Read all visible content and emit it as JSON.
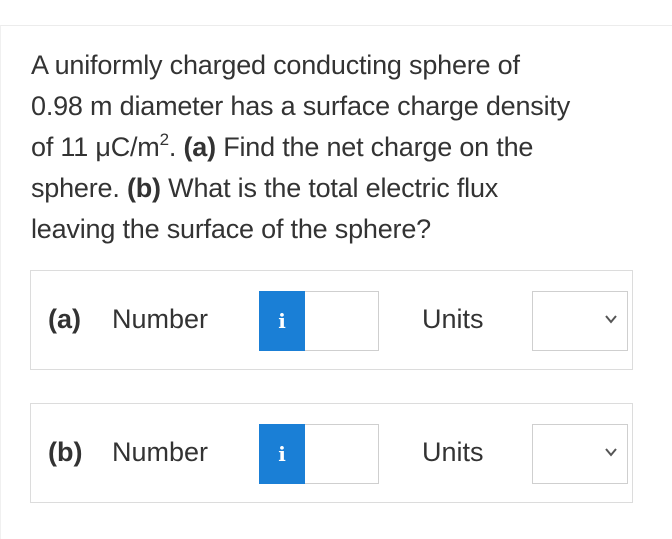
{
  "question": {
    "line1": "A uniformly charged conducting sphere of",
    "line2": "0.98 m diameter has a surface charge density",
    "line3_pre": "of 11 μC/m",
    "line3_sup": "2",
    "line3_post": ". ",
    "part_a_tag": "(a)",
    "line3_tail": " Find the net charge on the",
    "line4_pre": "sphere. ",
    "part_b_tag": "(b)",
    "line4_tail": " What is the total electric flux",
    "line5": "leaving the surface of the sphere?"
  },
  "answers": [
    {
      "part_label": "(a)",
      "number_label": "Number",
      "info_icon": "i",
      "number_value": "",
      "units_label": "Units",
      "units_value": ""
    },
    {
      "part_label": "(b)",
      "number_label": "Number",
      "info_icon": "i",
      "number_value": "",
      "units_label": "Units",
      "units_value": ""
    }
  ],
  "colors": {
    "info_button": "#1a7fd6",
    "text": "#333333",
    "border": "#dcdcdc"
  }
}
